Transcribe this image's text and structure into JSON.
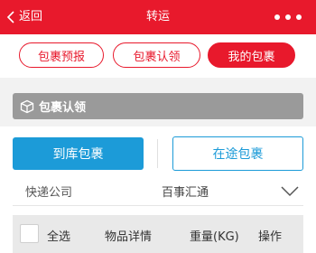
{
  "header": {
    "back_label": "返回",
    "title": "转运"
  },
  "tabs": [
    {
      "label": "包裹预报",
      "active": false
    },
    {
      "label": "包裹认领",
      "active": false
    },
    {
      "label": "我的包裹",
      "active": true
    }
  ],
  "section": {
    "title": "包裹认领"
  },
  "buttons": {
    "arrived": "到库包裹",
    "in_transit": "在途包裹"
  },
  "courier": {
    "label": "快递公司",
    "value": "百事汇通"
  },
  "table": {
    "select_all": "全选",
    "columns": [
      "物品详情",
      "重量(KG)",
      "操作"
    ]
  },
  "colors": {
    "brand_red": "#e8192c",
    "accent_blue": "#1c9bd8",
    "section_gray": "#9a9a9a"
  }
}
